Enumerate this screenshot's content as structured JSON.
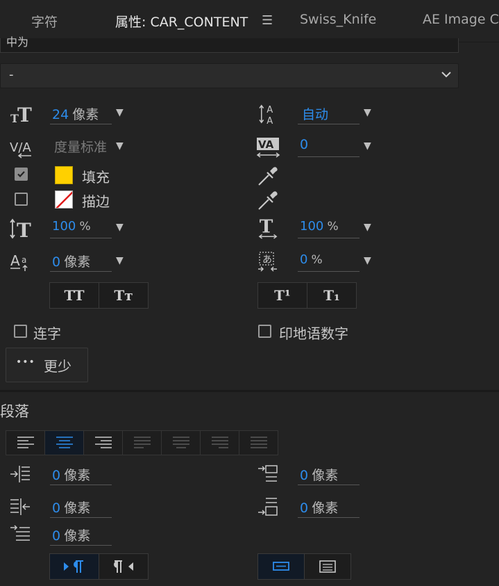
{
  "tabs": [
    {
      "label": "字符",
      "active": false
    },
    {
      "label": "属性: CAR_CONTENT",
      "active": true
    },
    {
      "label": "Swiss_Knife",
      "active": false
    },
    {
      "label": "AE Image Co",
      "active": false
    }
  ],
  "top_field": {
    "value": "中为"
  },
  "style_dropdown": {
    "value": "-"
  },
  "character": {
    "font_size": {
      "value": "24",
      "unit": "像素"
    },
    "leading": {
      "value": "自动"
    },
    "kerning": {
      "value": "度量标准"
    },
    "tracking": {
      "value": "0"
    },
    "fill": {
      "label": "填充",
      "checked": true,
      "color": "#ffd000"
    },
    "stroke": {
      "label": "描边",
      "checked": false,
      "color": "#ffffff",
      "slash_color": "#e01b1b"
    },
    "vertical_scale": {
      "value": "100",
      "unit": "%"
    },
    "horizontal_scale": {
      "value": "100",
      "unit": "%"
    },
    "baseline_shift": {
      "value": "0",
      "unit": "像素"
    },
    "tsume": {
      "value": "0",
      "unit": "%"
    },
    "caps_buttons": [
      "TT",
      "Tт"
    ],
    "script_buttons": [
      "T¹",
      "T₁"
    ],
    "ligatures": {
      "label": "连字",
      "checked": false
    },
    "hindi_digits": {
      "label": "印地语数字",
      "checked": false
    },
    "less_button": {
      "dots": "•••",
      "label": "更少"
    }
  },
  "paragraph": {
    "title": "段落",
    "indent_left": {
      "value": "0",
      "unit": "像素"
    },
    "space_before": {
      "value": "0",
      "unit": "像素"
    },
    "indent_right": {
      "value": "0",
      "unit": "像素"
    },
    "space_after": {
      "value": "0",
      "unit": "像素"
    },
    "first_line_indent": {
      "value": "0",
      "unit": "像素"
    }
  },
  "colors": {
    "accent": "#2d8ceb",
    "background": "#232323"
  }
}
